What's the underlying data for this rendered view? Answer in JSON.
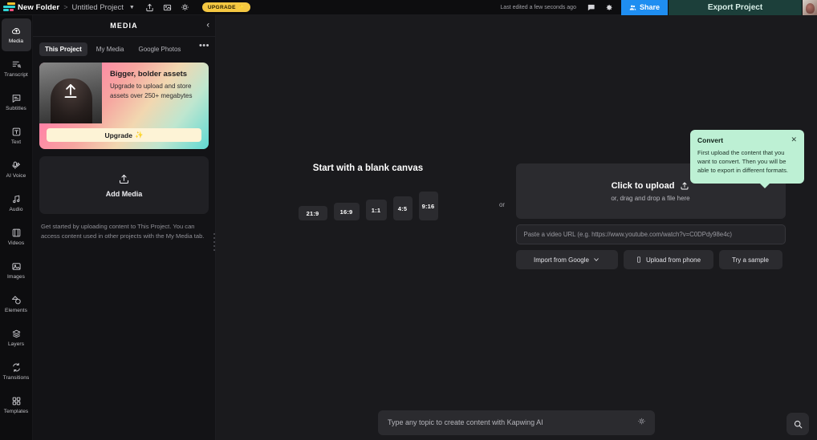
{
  "topbar": {
    "logo_icon": "kapwing-logo-icon",
    "folder": "New Folder",
    "separator": ">",
    "project": "Untitled Project",
    "project_chevron": "chevron-down-icon",
    "share_icon": "share-export-icon",
    "image_icon": "image-icon",
    "idea_icon": "lightbulb-icon",
    "upgrade_label": "UPGRADE",
    "upgrade_spark": "✨",
    "last_edited": "Last edited a few seconds ago",
    "comment_icon": "comment-icon",
    "settings_icon": "gear-icon",
    "share_label": "Share",
    "share_people_icon": "people-icon",
    "export_label": "Export Project",
    "avatar": "user-avatar"
  },
  "rail": {
    "items": [
      {
        "label": "Media",
        "icon": "media-cloud-icon",
        "active": true
      },
      {
        "label": "Transcript",
        "icon": "transcript-icon",
        "active": false
      },
      {
        "label": "Subtitles",
        "icon": "subtitles-icon",
        "active": false
      },
      {
        "label": "Text",
        "icon": "text-edit-icon",
        "active": false
      },
      {
        "label": "AI Voice",
        "icon": "ai-voice-icon",
        "active": false
      },
      {
        "label": "Audio",
        "icon": "audio-note-icon",
        "active": false
      },
      {
        "label": "Videos",
        "icon": "video-film-icon",
        "active": false
      },
      {
        "label": "Images",
        "icon": "image-photo-icon",
        "active": false
      },
      {
        "label": "Elements",
        "icon": "elements-shape-icon",
        "active": false
      },
      {
        "label": "Layers",
        "icon": "layers-stack-icon",
        "active": false
      },
      {
        "label": "Transitions",
        "icon": "transitions-icon",
        "active": false
      },
      {
        "label": "Templates",
        "icon": "templates-grid-icon",
        "active": false
      }
    ]
  },
  "panel": {
    "title": "MEDIA",
    "collapse_icon": "chevron-left-icon",
    "more_icon": "more-options-icon",
    "tabs": [
      {
        "label": "This Project",
        "active": true
      },
      {
        "label": "My Media",
        "active": false
      },
      {
        "label": "Google Photos",
        "active": false
      }
    ],
    "promo": {
      "heading": "Bigger, bolder assets",
      "body": "Upgrade to upload and store assets over 250+ megabytes",
      "button_label": "Upgrade",
      "button_spark": "✨",
      "thumb_icon": "upload-arrow-icon"
    },
    "add_media": {
      "label": "Add Media",
      "icon": "upload-tray-icon"
    },
    "note": "Get started by uploading content to This Project. You can access content used in other projects with the My Media tab."
  },
  "canvas": {
    "blank": {
      "title": "Start with a blank canvas",
      "ratios": [
        "21:9",
        "16:9",
        "1:1",
        "4:5",
        "9:16"
      ]
    },
    "or_label": "or",
    "upload": {
      "click_label": "Click to upload",
      "click_icon": "upload-tray-icon",
      "drag_label": "or, drag and drop a file here",
      "url_placeholder": "Paste a video URL (e.g. https://www.youtube.com/watch?v=C0DPdy98e4c)",
      "quick_buttons": [
        {
          "label": "Import from Google",
          "icon": "chevron-down-icon"
        },
        {
          "label": "Upload from phone",
          "icon": "phone-icon"
        },
        {
          "label": "Try a sample",
          "icon": ""
        }
      ]
    },
    "tooltip": {
      "title": "Convert",
      "close_icon": "close-icon",
      "body": "First upload the content that you want to convert. Then you will be able to export in different formats."
    }
  },
  "bottom": {
    "ai_placeholder": "Type any topic to create content with Kapwing AI",
    "ai_icon": "sparkle-idea-icon",
    "search_icon": "search-icon"
  },
  "colors": {
    "accent_blue": "#1f8ef1",
    "export_teal": "#1c3f3a",
    "upgrade_yellow": "#f5c842",
    "tooltip_mint": "#bdf0d4",
    "bg_dark": "#0d0d0f",
    "canvas_bg": "#1a1a1d"
  }
}
